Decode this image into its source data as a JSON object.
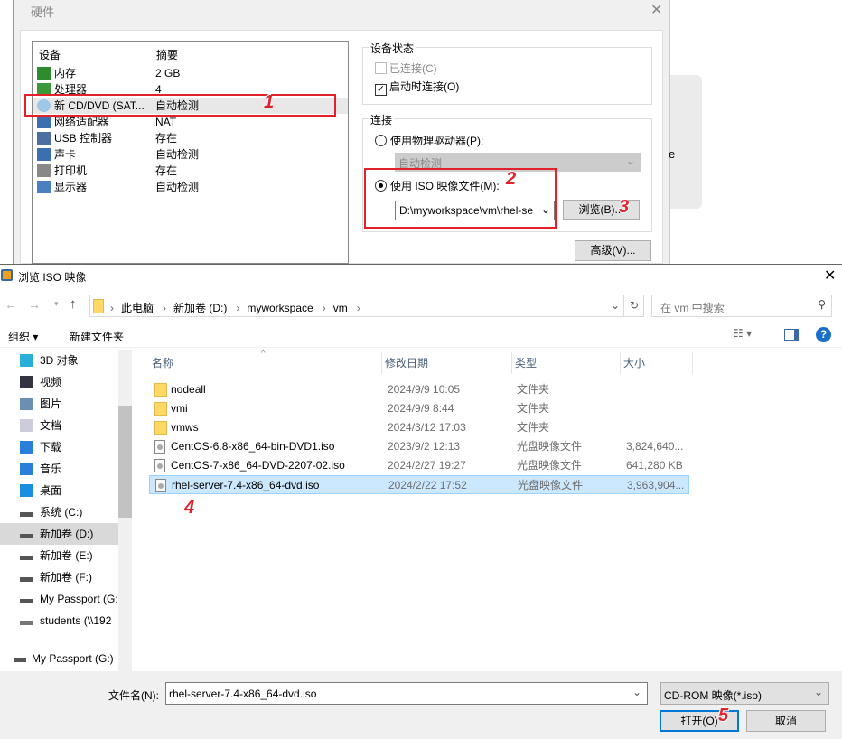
{
  "hardware": {
    "title": "硬件",
    "close": "✕",
    "columns": [
      "设备",
      "摘要"
    ],
    "devices": [
      {
        "name": "内存",
        "summary": "2 GB",
        "icon": "memory-icon"
      },
      {
        "name": "处理器",
        "summary": "4",
        "icon": "cpu-icon"
      },
      {
        "name": "新 CD/DVD (SAT...",
        "summary": "自动检测",
        "icon": "cd-icon",
        "selected": true
      },
      {
        "name": "网络适配器",
        "summary": "NAT",
        "icon": "network-icon"
      },
      {
        "name": "USB 控制器",
        "summary": "存在",
        "icon": "usb-icon"
      },
      {
        "name": "声卡",
        "summary": "自动检测",
        "icon": "speaker-icon"
      },
      {
        "name": "打印机",
        "summary": "存在",
        "icon": "printer-icon"
      },
      {
        "name": "显示器",
        "summary": "自动检测",
        "icon": "monitor-icon"
      }
    ],
    "device_status": {
      "legend": "设备状态",
      "connected": "已连接(C)",
      "connect_on_power": "启动时连接(O)",
      "connected_checked": false,
      "connect_on_power_checked": true
    },
    "connection": {
      "legend": "连接",
      "physical": "使用物理驱动器(P):",
      "physical_value": "自动检测",
      "iso": "使用 ISO 映像文件(M):",
      "iso_selected": true,
      "iso_path": "D:\\myworkspace\\vm\\rhel-se",
      "browse": "浏览(B)..."
    },
    "advanced": "高级(V)..."
  },
  "annotations": [
    "1",
    "2",
    "3",
    "4",
    "5"
  ],
  "side_card_text": "e",
  "browse": {
    "title": "浏览 ISO 映像",
    "close": "✕",
    "breadcrumb": [
      "此电脑",
      "新加卷 (D:)",
      "myworkspace",
      "vm"
    ],
    "search_placeholder": "在 vm 中搜索",
    "organize": "组织 ▾",
    "new_folder": "新建文件夹",
    "nav": [
      {
        "label": "3D 对象",
        "icon": "3d-objects-icon"
      },
      {
        "label": "视频",
        "icon": "video-icon"
      },
      {
        "label": "图片",
        "icon": "pictures-icon"
      },
      {
        "label": "文档",
        "icon": "documents-icon"
      },
      {
        "label": "下载",
        "icon": "download-icon"
      },
      {
        "label": "音乐",
        "icon": "music-icon"
      },
      {
        "label": "桌面",
        "icon": "desktop-icon"
      },
      {
        "label": "系统 (C:)",
        "icon": "drive-icon"
      },
      {
        "label": "新加卷 (D:)",
        "icon": "drive-icon",
        "selected": true
      },
      {
        "label": "新加卷 (E:)",
        "icon": "drive-icon"
      },
      {
        "label": "新加卷 (F:)",
        "icon": "drive-icon"
      },
      {
        "label": "My Passport (G:)",
        "icon": "drive-icon"
      },
      {
        "label": "students (\\\\192",
        "icon": "network-drive-icon"
      }
    ],
    "nav_extra": "My Passport (G:)",
    "columns": [
      "名称",
      "修改日期",
      "类型",
      "大小"
    ],
    "files": [
      {
        "name": "nodeall",
        "date": "2024/9/9 10:05",
        "type": "文件夹",
        "size": "",
        "kind": "folder"
      },
      {
        "name": "vmi",
        "date": "2024/9/9 8:44",
        "type": "文件夹",
        "size": "",
        "kind": "folder"
      },
      {
        "name": "vmws",
        "date": "2024/3/12 17:03",
        "type": "文件夹",
        "size": "",
        "kind": "folder"
      },
      {
        "name": "CentOS-6.8-x86_64-bin-DVD1.iso",
        "date": "2023/9/2 12:13",
        "type": "光盘映像文件",
        "size": "3,824,640...",
        "kind": "iso"
      },
      {
        "name": "CentOS-7-x86_64-DVD-2207-02.iso",
        "date": "2024/2/27 19:27",
        "type": "光盘映像文件",
        "size": "641,280 KB",
        "kind": "iso"
      },
      {
        "name": "rhel-server-7.4-x86_64-dvd.iso",
        "date": "2024/2/22 17:52",
        "type": "光盘映像文件",
        "size": "3,963,904...",
        "kind": "iso",
        "selected": true
      }
    ],
    "filename_label": "文件名(N):",
    "filename_value": "rhel-server-7.4-x86_64-dvd.iso",
    "filter": "CD-ROM 映像(*.iso)",
    "open": "打开(O)",
    "cancel": "取消"
  },
  "colors": {
    "annotation": "#e3212b",
    "selection": "#cce8ff",
    "accent": "#0078d7"
  }
}
